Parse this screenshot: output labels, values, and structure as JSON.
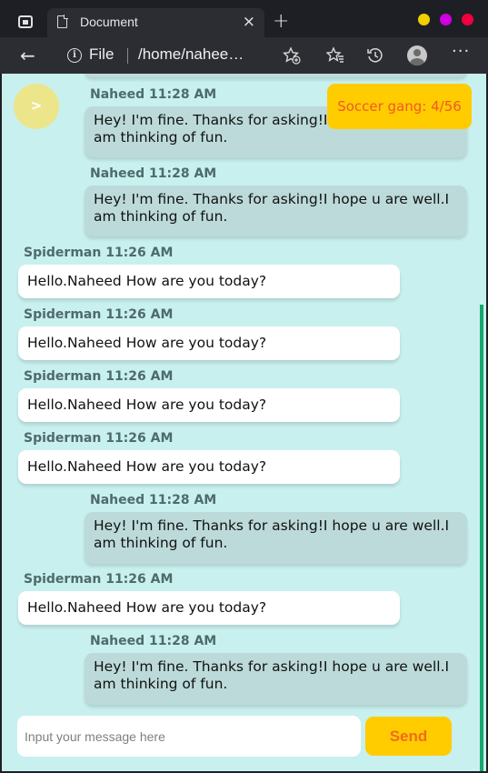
{
  "browser": {
    "tab_title": "Document",
    "close_glyph": "×",
    "new_tab_glyph": "+",
    "back_glyph": "←",
    "info_glyph": "i",
    "file_label": "File",
    "url": "/home/nahee…",
    "more_glyph": "···",
    "icons": [
      "reading-list-add-icon",
      "favorites-icon",
      "history-icon",
      "profile-icon"
    ]
  },
  "chat": {
    "toggle_label": ">",
    "group_badge": "Soccer gang: 4/56",
    "messages": [
      {
        "sender": "Naheed",
        "time": "11:28 AM",
        "text": "Hey! I'm fine. Thanks for asking!I hope u are well.I am thinking of fun.",
        "mine": true
      },
      {
        "sender": "Naheed",
        "time": "11:28 AM",
        "text": "Hey! I'm fine. Thanks for asking!I hope u are well.I am thinking of fun.",
        "mine": true
      },
      {
        "sender": "Spiderman",
        "time": "11:26 AM",
        "text": "Hello.Naheed How are you today?",
        "mine": false
      },
      {
        "sender": "Spiderman",
        "time": "11:26 AM",
        "text": "Hello.Naheed How are you today?",
        "mine": false
      },
      {
        "sender": "Spiderman",
        "time": "11:26 AM",
        "text": "Hello.Naheed How are you today?",
        "mine": false
      },
      {
        "sender": "Spiderman",
        "time": "11:26 AM",
        "text": "Hello.Naheed How are you today?",
        "mine": false
      },
      {
        "sender": "Naheed",
        "time": "11:28 AM",
        "text": "Hey! I'm fine. Thanks for asking!I hope u are well.I am thinking of fun.",
        "mine": true
      },
      {
        "sender": "Spiderman",
        "time": "11:26 AM",
        "text": "Hello.Naheed How are you today?",
        "mine": false
      },
      {
        "sender": "Naheed",
        "time": "11:28 AM",
        "text": "Hey! I'm fine. Thanks for asking!I hope u are well.I am thinking of fun.",
        "mine": true
      }
    ],
    "input": {
      "value": "",
      "placeholder": "Input your message here"
    },
    "send_label": "Send"
  },
  "colors": {
    "page_bg": "#c8f0ee",
    "mine_bubble": "#bcdada",
    "theirs_bubble": "#ffffff",
    "accent": "#ffcc00",
    "accent_text": "#f06d1a",
    "scroll_thumb": "#17a86f"
  }
}
